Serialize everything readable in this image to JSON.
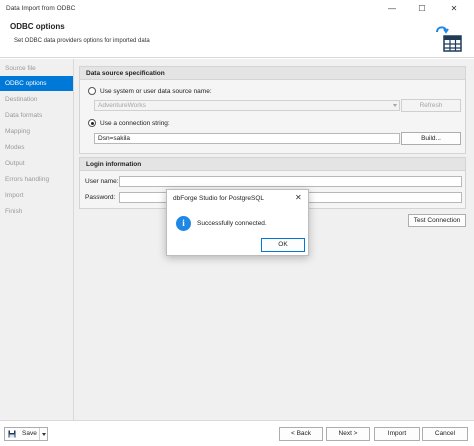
{
  "window": {
    "title": "Data Import from ODBC",
    "minimize_glyph": "—",
    "maximize_glyph": "☐",
    "close_glyph": "✕"
  },
  "header": {
    "title": "ODBC options",
    "subtitle": "Set ODBC data providers options for imported data",
    "icon": "odbc-table-icon"
  },
  "sidebar": {
    "items": [
      {
        "label": "Source file",
        "active": false
      },
      {
        "label": "ODBC options",
        "active": true
      },
      {
        "label": "Destination",
        "active": false
      },
      {
        "label": "Data formats",
        "active": false
      },
      {
        "label": "Mapping",
        "active": false
      },
      {
        "label": "Modes",
        "active": false
      },
      {
        "label": "Output",
        "active": false
      },
      {
        "label": "Errors handling",
        "active": false
      },
      {
        "label": "Import",
        "active": false
      },
      {
        "label": "Finish",
        "active": false
      }
    ]
  },
  "datasource": {
    "heading": "Data source specification",
    "dsn_radio_label": "Use system or user data source name:",
    "dsn_value": "AdventureWorks",
    "refresh_label": "Refresh",
    "conn_radio_label": "Use a connection string:",
    "conn_value": "Dsn=sakila",
    "build_label": "Build..."
  },
  "login": {
    "heading": "Login information",
    "user_label": "User name:",
    "user_value": "",
    "password_label": "Password:",
    "password_value": ""
  },
  "test_connection_label": "Test Connection",
  "dialog": {
    "title": "dbForge Studio for PostgreSQL",
    "message": "Successfully connected.",
    "ok_label": "OK",
    "close_glyph": "✕",
    "icon_glyph": "i"
  },
  "footer": {
    "save_label": "Save",
    "back_label": "< Back",
    "next_label": "Next >",
    "import_label": "Import",
    "cancel_label": "Cancel"
  },
  "colors": {
    "accent": "#0078d7",
    "info_blue": "#1e88e5"
  }
}
